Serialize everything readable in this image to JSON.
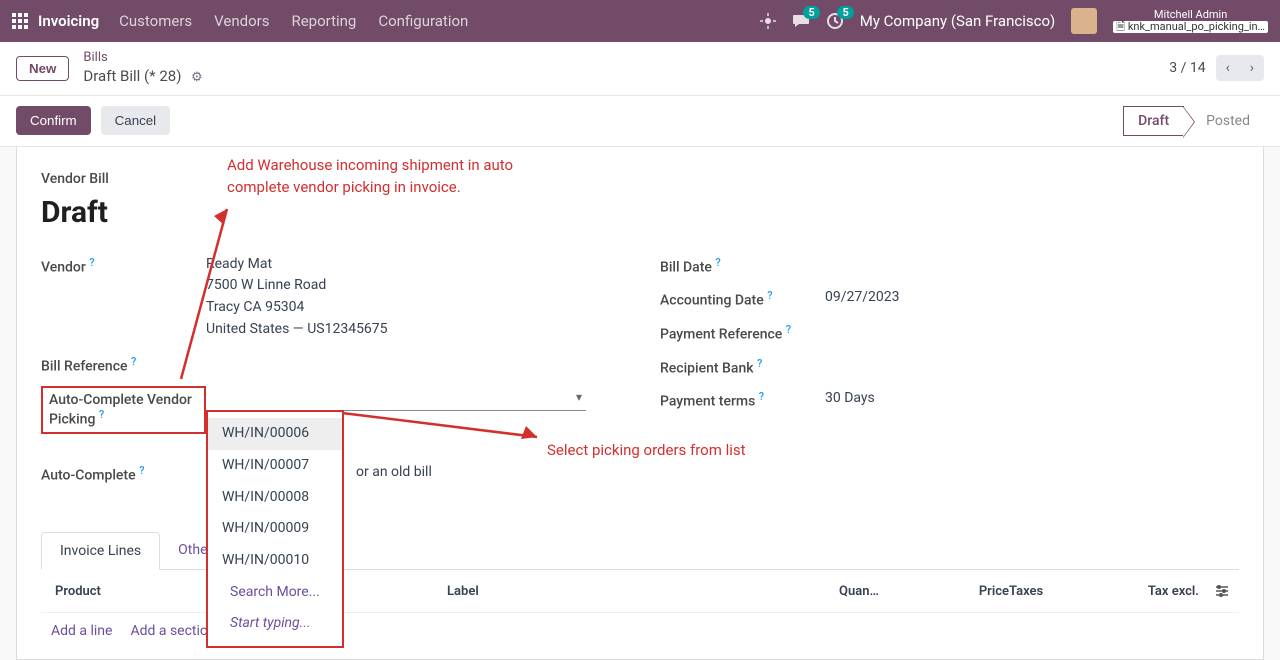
{
  "navbar": {
    "brand": "Invoicing",
    "items": [
      "Customers",
      "Vendors",
      "Reporting",
      "Configuration"
    ],
    "badge1": "5",
    "badge2": "5",
    "company": "My Company (San Francisco)",
    "user_name": "Mitchell Admin",
    "user_sub": "knk_manual_po_picking_in…"
  },
  "subheader": {
    "new_label": "New",
    "crumb1": "Bills",
    "crumb2": "Draft Bill (* 28)",
    "pager": "3 / 14"
  },
  "actions": {
    "confirm": "Confirm",
    "cancel": "Cancel",
    "status_active": "Draft",
    "status_inactive": "Posted"
  },
  "form": {
    "title_small": "Vendor Bill",
    "title_big": "Draft",
    "left": {
      "vendor_label": "Vendor",
      "vendor_name": "Ready Mat",
      "vendor_addr1": "7500 W Linne Road",
      "vendor_addr2": "Tracy CA 95304",
      "vendor_addr3": "United States — US12345675",
      "billref_label": "Bill Reference",
      "acvp_label": "Auto-Complete Vendor Picking",
      "ac_label": "Auto-Complete",
      "ac_placeholder": "or an old bill"
    },
    "right": {
      "billdate_label": "Bill Date",
      "acctdate_label": "Accounting Date",
      "acctdate_val": "09/27/2023",
      "payref_label": "Payment Reference",
      "recipbank_label": "Recipient Bank",
      "payterms_label": "Payment terms",
      "payterms_val": "30 Days"
    },
    "dropdown": {
      "options": [
        "WH/IN/00006",
        "WH/IN/00007",
        "WH/IN/00008",
        "WH/IN/00009",
        "WH/IN/00010"
      ],
      "search_more": "Search More...",
      "start_typing": "Start typing..."
    }
  },
  "tabs": {
    "tab1": "Invoice Lines",
    "tab2": "Other"
  },
  "grid": {
    "headers": {
      "product": "Product",
      "label": "Label",
      "qty": "Quan…",
      "price": "Price",
      "taxes": "Taxes",
      "taxexcl": "Tax excl."
    },
    "addline": "Add a line",
    "addsection": "Add a sectio"
  },
  "annotations": {
    "a1": "Add Warehouse incoming shipment in auto complete vendor picking in invoice.",
    "a2": "Select picking orders from list"
  }
}
